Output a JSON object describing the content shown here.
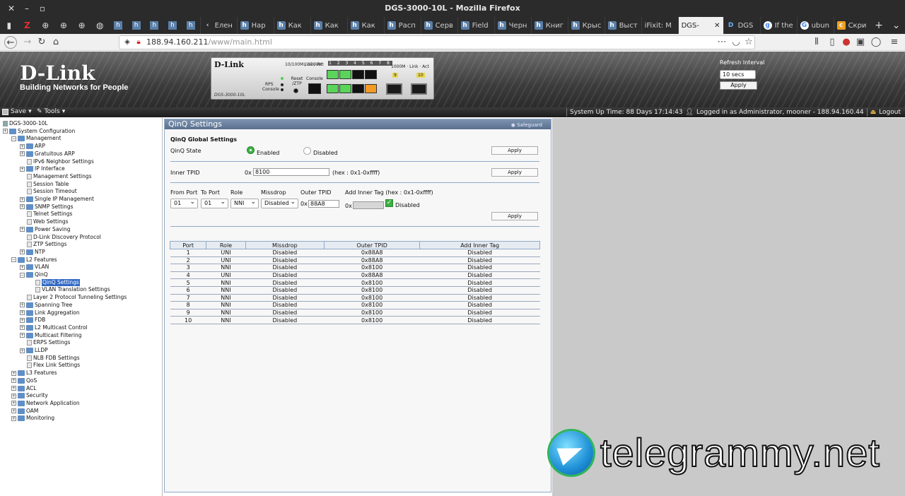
{
  "window": {
    "title": "DGS-3000-10L - Mozilla Firefox"
  },
  "tabs": [
    {
      "label": "Елен",
      "icon": "back"
    },
    {
      "label": "Нар",
      "icon": "h"
    },
    {
      "label": "Как",
      "icon": "h"
    },
    {
      "label": "Как",
      "icon": "h"
    },
    {
      "label": "Как",
      "icon": "h"
    },
    {
      "label": "Расп",
      "icon": "h"
    },
    {
      "label": "Серв",
      "icon": "h"
    },
    {
      "label": "Field",
      "icon": "h"
    },
    {
      "label": "Черн",
      "icon": "h"
    },
    {
      "label": "Книг",
      "icon": "h"
    },
    {
      "label": "Крыс",
      "icon": "h"
    },
    {
      "label": "Выст",
      "icon": "h"
    },
    {
      "label": "iFixit: M",
      "icon": "i"
    },
    {
      "label": "DGS-",
      "icon": "dlink",
      "active": true
    },
    {
      "label": "DGS",
      "icon": "D"
    },
    {
      "label": "If the",
      "icon": "g"
    },
    {
      "label": "ubun",
      "icon": "G"
    },
    {
      "label": "Скри",
      "icon": "c"
    }
  ],
  "address": {
    "host": "188.94.160.211",
    "path": "/www/main.html"
  },
  "header": {
    "logo_main": "D-Link",
    "logo_sub": "Building Networks for People",
    "device_brand": "D-Link",
    "device_model": "DGS-3000-10L",
    "device_labels": {
      "rps": "RPS",
      "console": "Console",
      "reset": "Reset /ZTP",
      "console2": "Console",
      "speed": "10/100M / 1000M",
      "link_act": "Link / Act",
      "ports_top": [
        "1",
        "2",
        "3",
        "4",
        "5",
        "6",
        "7",
        "8"
      ],
      "sfp_labels": [
        "9",
        "10"
      ]
    },
    "refresh": {
      "label": "Refresh Interval",
      "value": "10 secs",
      "apply": "Apply"
    }
  },
  "toolbar": {
    "save": "Save",
    "tools": "Tools",
    "uptime": "System Up Time: 88 Days 17:14:43",
    "logged_in": "Logged in as Administrator, mooner - 188.94.160.44",
    "logout": "Logout"
  },
  "tree": [
    {
      "label": "DGS-3000-10L",
      "type": "root"
    },
    {
      "label": "System Configuration",
      "type": "folder"
    },
    {
      "label": "Management",
      "type": "folder",
      "expanded": true
    },
    {
      "label": "ARP",
      "type": "folder"
    },
    {
      "label": "Gratuitous ARP",
      "type": "folder"
    },
    {
      "label": "IPv6 Neighbor Settings",
      "type": "doc"
    },
    {
      "label": "IP Interface",
      "type": "folder"
    },
    {
      "label": "Management Settings",
      "type": "doc"
    },
    {
      "label": "Session Table",
      "type": "doc"
    },
    {
      "label": "Session Timeout",
      "type": "doc"
    },
    {
      "label": "Single IP Management",
      "type": "folder"
    },
    {
      "label": "SNMP Settings",
      "type": "folder"
    },
    {
      "label": "Telnet Settings",
      "type": "doc"
    },
    {
      "label": "Web Settings",
      "type": "doc"
    },
    {
      "label": "Power Saving",
      "type": "folder"
    },
    {
      "label": "D-Link Discovery Protocol",
      "type": "doc"
    },
    {
      "label": "ZTP Settings",
      "type": "doc"
    },
    {
      "label": "NTP",
      "type": "folder"
    },
    {
      "label": "L2 Features",
      "type": "folder",
      "expanded": true
    },
    {
      "label": "VLAN",
      "type": "folder"
    },
    {
      "label": "QinQ",
      "type": "folder",
      "expanded": true
    },
    {
      "label": "QinQ Settings",
      "type": "doc",
      "selected": true
    },
    {
      "label": "VLAN Translation Settings",
      "type": "doc"
    },
    {
      "label": "Layer 2 Protocol Tunneling Settings",
      "type": "doc"
    },
    {
      "label": "Spanning Tree",
      "type": "folder"
    },
    {
      "label": "Link Aggregation",
      "type": "folder"
    },
    {
      "label": "FDB",
      "type": "folder"
    },
    {
      "label": "L2 Multicast Control",
      "type": "folder"
    },
    {
      "label": "Multicast Filtering",
      "type": "folder"
    },
    {
      "label": "ERPS Settings",
      "type": "doc"
    },
    {
      "label": "LLDP",
      "type": "folder"
    },
    {
      "label": "NLB FDB Settings",
      "type": "doc"
    },
    {
      "label": "Flex Link Settings",
      "type": "doc"
    },
    {
      "label": "L3 Features",
      "type": "folder"
    },
    {
      "label": "QoS",
      "type": "folder"
    },
    {
      "label": "ACL",
      "type": "folder"
    },
    {
      "label": "Security",
      "type": "folder"
    },
    {
      "label": "Network Application",
      "type": "folder"
    },
    {
      "label": "OAM",
      "type": "folder"
    },
    {
      "label": "Monitoring",
      "type": "folder"
    }
  ],
  "panel": {
    "title": "QinQ Settings",
    "safeguard": "Safeguard",
    "global_heading": "QinQ Global Settings",
    "state_label": "QinQ State",
    "enabled_label": "Enabled",
    "disabled_label": "Disabled",
    "state_value": "Enabled",
    "apply": "Apply",
    "inner_tpid_label": "Inner TPID",
    "inner_tpid_prefix": "0x",
    "inner_tpid_value": "8100",
    "inner_tpid_hint": "(hex : 0x1-0xffff)",
    "port_form": {
      "from_port_label": "From Port",
      "to_port_label": "To Port",
      "role_label": "Role",
      "missdrop_label": "Missdrop",
      "outer_tpid_label": "Outer TPID",
      "add_inner_label": "Add Inner Tag (hex : 0x1-0xffff)",
      "from_port": "01",
      "to_port": "01",
      "role": "NNI",
      "missdrop": "Disabled",
      "outer_prefix": "0x",
      "outer_tpid": "88A8",
      "inner_prefix": "0x",
      "inner_tag": "",
      "inner_disabled_label": "Disabled"
    },
    "table": {
      "headers": [
        "Port",
        "Role",
        "Missdrop",
        "Outer TPID",
        "Add Inner Tag"
      ],
      "rows": [
        [
          "1",
          "UNI",
          "Disabled",
          "0x88A8",
          "Disabled"
        ],
        [
          "2",
          "UNI",
          "Disabled",
          "0x88A8",
          "Disabled"
        ],
        [
          "3",
          "NNI",
          "Disabled",
          "0x8100",
          "Disabled"
        ],
        [
          "4",
          "UNI",
          "Disabled",
          "0x88A8",
          "Disabled"
        ],
        [
          "5",
          "NNI",
          "Disabled",
          "0x8100",
          "Disabled"
        ],
        [
          "6",
          "NNI",
          "Disabled",
          "0x8100",
          "Disabled"
        ],
        [
          "7",
          "NNI",
          "Disabled",
          "0x8100",
          "Disabled"
        ],
        [
          "8",
          "NNI",
          "Disabled",
          "0x8100",
          "Disabled"
        ],
        [
          "9",
          "NNI",
          "Disabled",
          "0x8100",
          "Disabled"
        ],
        [
          "10",
          "NNI",
          "Disabled",
          "0x8100",
          "Disabled"
        ]
      ]
    }
  },
  "watermark": "telegrammy.net"
}
